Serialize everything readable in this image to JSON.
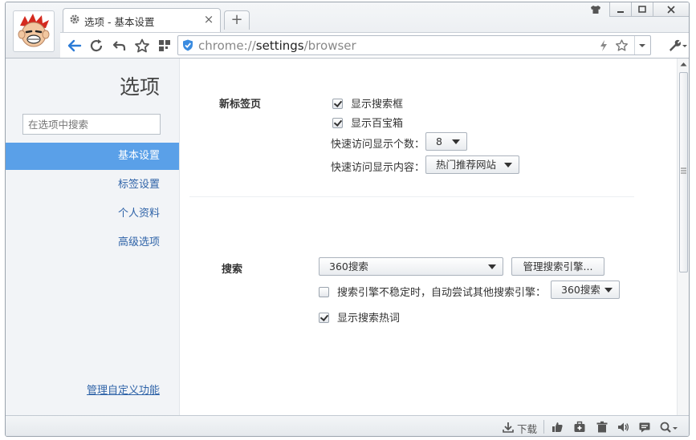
{
  "browser": {
    "tab_title": "选项 - 基本设置",
    "tab_close": "×",
    "new_tab": "+",
    "url_prefix": "chrome://",
    "url_host": "settings",
    "url_path": "/browser"
  },
  "sidebar": {
    "title": "选项",
    "search_placeholder": "在选项中搜索",
    "items": [
      {
        "label": "基本设置",
        "active": true
      },
      {
        "label": "标签设置",
        "active": false
      },
      {
        "label": "个人资料",
        "active": false
      },
      {
        "label": "高级选项",
        "active": false
      }
    ],
    "manage_link": "管理自定义功能"
  },
  "newtab_section": {
    "label": "新标签页",
    "show_search_box": "显示搜索框",
    "show_baibaoxiang": "显示百宝箱",
    "quick_count_label": "快速访问显示个数：",
    "quick_count_value": "8",
    "quick_content_label": "快速访问显示内容：",
    "quick_content_value": "热门推荐网站"
  },
  "search_section": {
    "label": "搜索",
    "engine_value": "360搜索",
    "manage_button": "管理搜索引擎...",
    "fallback_label": "搜索引擎不稳定时，自动尝试其他搜索引擎：",
    "fallback_value": "360搜索",
    "show_hot_words": "显示搜索热词"
  },
  "statusbar": {
    "download_label": "下载"
  },
  "colors": {
    "accent": "#5aa0e8",
    "link": "#2f63a8",
    "back_arrow": "#2c7bd6"
  }
}
